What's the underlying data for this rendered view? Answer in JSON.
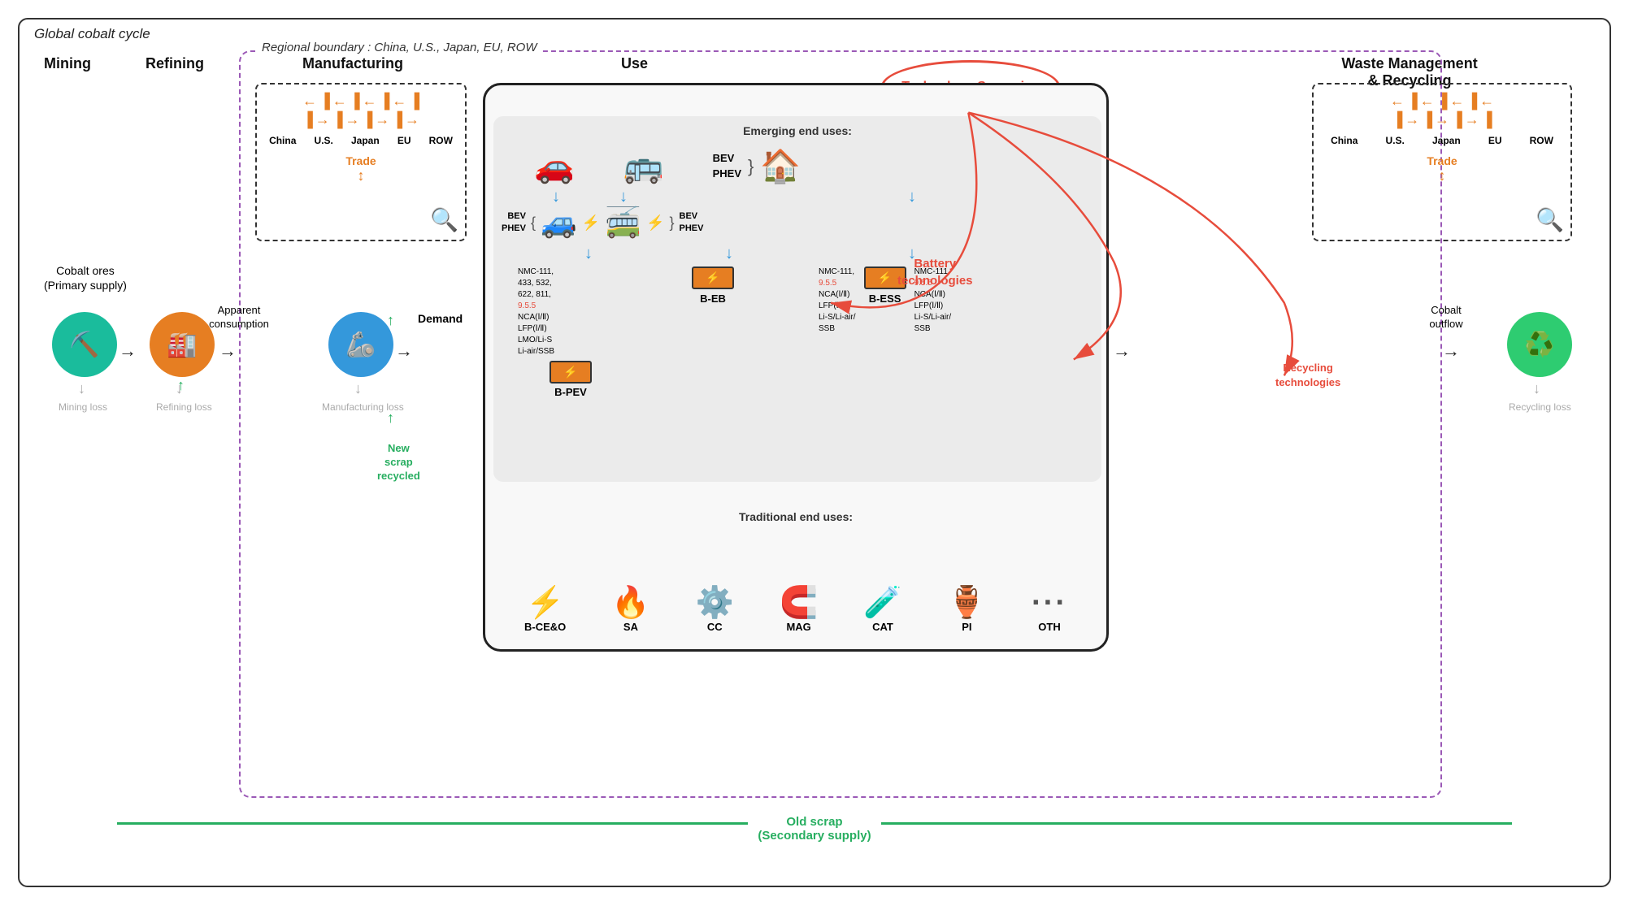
{
  "title": "Global cobalt cycle",
  "regional_boundary_label": "Regional boundary : China, U.S., Japan, EU, ROW",
  "sections": {
    "mining": "Mining",
    "refining": "Refining",
    "manufacturing": "Manufacturing",
    "use": "Use",
    "waste": "Waste Management\n& Recycling"
  },
  "tech_scenarios": "Technology Scenarios",
  "battery_technologies": "Battery\ntechnologies",
  "recycling_technologies": "Recycling\ntechnologies",
  "regions": [
    "China",
    "U.S.",
    "Japan",
    "EU",
    "ROW"
  ],
  "trade_label": "Trade",
  "flow_labels": {
    "cobalt_ores": "Cobalt ores\n(Primary supply)",
    "apparent_consumption": "Apparent\nconsumption",
    "demand": "Demand",
    "cobalt_outflow": "Cobalt\noutflow",
    "new_scrap": "New\nscrap\nrecycled",
    "old_scrap": "Old scrap\n(Secondary supply)"
  },
  "loss_labels": {
    "mining": "Mining\nloss",
    "refining": "Refining\nloss",
    "manufacturing": "Manufacturing\nloss",
    "recycling": "Recycling\nloss"
  },
  "emerging_end_uses": "Emerging end uses:",
  "traditional_end_uses": "Traditional end uses:",
  "bev_phev": "BEV\nPHEV",
  "battery_types": {
    "b_pev": "B-PEV",
    "b_eb": "B-EB",
    "b_ess": "B-ESS"
  },
  "nmc_labels": {
    "left": "NMC-111,\n433, 532,\n622, 811,\n9.5.5\nNCA(Ⅰ/Ⅱ)\nLFP(Ⅰ/Ⅱ)\nLMO/Li-S\nLi-air/SSB",
    "right": "NMC-111,\n9.5.5\nNCA(Ⅰ/Ⅱ)\nLFP(Ⅰ/Ⅱ)\nLi-S/Li-air/\nSSB",
    "ess": "NMC-111,\n9.5.5\nNCA(Ⅰ/Ⅱ)\nLFP(Ⅰ/Ⅱ)\nLi-S/Li-air/\nSSB"
  },
  "traditional_items": [
    {
      "icon": "⚡",
      "label": "B-CE&O",
      "color": "#27ae60"
    },
    {
      "icon": "🔥",
      "label": "SA",
      "color": "#e67e22"
    },
    {
      "icon": "⚙️",
      "label": "CC",
      "color": "#3498db"
    },
    {
      "icon": "🧲",
      "label": "MAG",
      "color": "#e74c3c"
    },
    {
      "icon": "🧪",
      "label": "CAT",
      "color": "#95a5a6"
    },
    {
      "icon": "🏺",
      "label": "PI",
      "color": "#a0522d"
    },
    {
      "icon": "···",
      "label": "OTH",
      "color": "#555"
    }
  ],
  "colors": {
    "teal": "#1abc9c",
    "orange": "#e67e22",
    "blue": "#3498db",
    "green": "#2ecc71",
    "red": "#e74c3c",
    "purple": "#9b59b6",
    "dark": "#222"
  }
}
